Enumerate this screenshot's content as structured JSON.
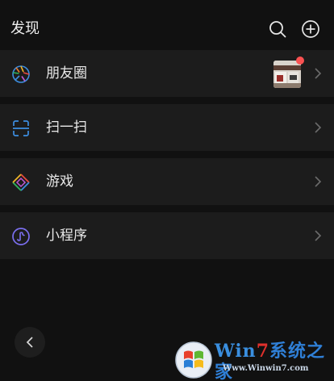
{
  "header": {
    "title": "发现",
    "search_icon": "search-icon",
    "add_icon": "plus-circle-icon"
  },
  "items": [
    {
      "label": "朋友圈",
      "icon": "moments-aperture-icon",
      "has_thumbnail": true,
      "has_badge_dot": true,
      "badge_color": "#fa5151"
    },
    {
      "label": "扫一扫",
      "icon": "scan-icon"
    },
    {
      "label": "游戏",
      "icon": "game-diamond-icon"
    },
    {
      "label": "小程序",
      "icon": "mini-program-icon"
    }
  ],
  "nav": {
    "back_icon": "chevron-left-icon"
  },
  "watermark": {
    "brand_part1": "Win",
    "brand_part2": "7",
    "brand_part3": "系统之家",
    "url": "Www.Winwin7.com"
  },
  "colors": {
    "background": "#111111",
    "row": "#1c1c1c",
    "text": "#e9e9e9",
    "chevron": "#6b6b6b",
    "red_dot": "#fa5151"
  }
}
